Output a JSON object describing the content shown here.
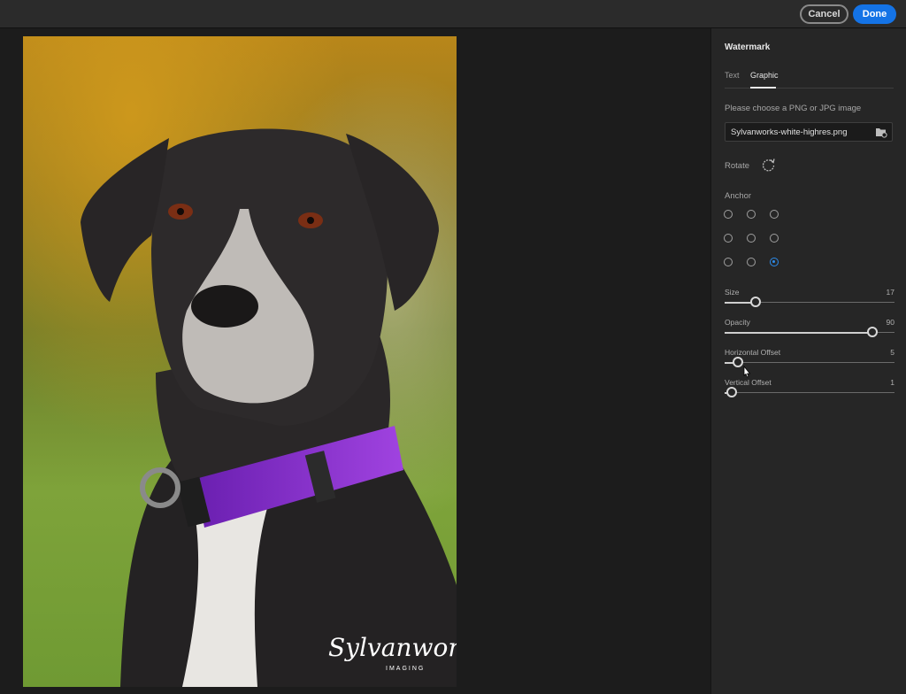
{
  "toolbar": {
    "cancel_label": "Cancel",
    "done_label": "Done"
  },
  "photo": {
    "watermark_script": "Sylvanworks",
    "watermark_sub": "IMAGING"
  },
  "panel": {
    "title": "Watermark",
    "tabs": [
      {
        "label": "Text",
        "active": false
      },
      {
        "label": "Graphic",
        "active": true
      }
    ],
    "choose_label": "Please choose a PNG or JPG image",
    "file_value": "Sylvanworks-white-highres.png",
    "rotate_label": "Rotate",
    "anchor_label": "Anchor",
    "anchor_selected": "bottom-right",
    "sliders": {
      "size": {
        "label": "Size",
        "value": "17",
        "fraction": 0.18
      },
      "opacity": {
        "label": "Opacity",
        "value": "90",
        "fraction": 0.87
      },
      "horizontal_offset": {
        "label": "Horizontal Offset",
        "value": "5",
        "fraction": 0.08
      },
      "vertical_offset": {
        "label": "Vertical Offset",
        "value": "1",
        "fraction": 0.04
      }
    }
  },
  "colors": {
    "accent": "#1473e6",
    "collar": "#8a2fd0"
  },
  "icons": {
    "file": "folder-icon",
    "rotate": "rotate-icon",
    "cursor": "pointer-cursor-icon"
  }
}
